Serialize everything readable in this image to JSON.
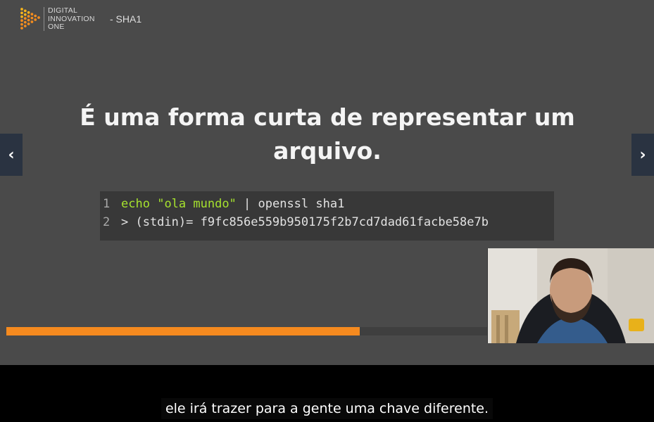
{
  "brand": {
    "name_lines": [
      "DIGITAL",
      "INNOVATION",
      "ONE"
    ],
    "slide_tag": "- SHA1",
    "logo_colors": [
      "#f6b31c",
      "#f28c1f",
      "#e24a2a",
      "#c0143c"
    ]
  },
  "slide": {
    "title": "É uma forma curta de representar um arquivo.",
    "code": {
      "lines": [
        {
          "number": "1",
          "keyword": "echo",
          "string": "\"ola mundo\"",
          "rest": " | openssl sha1"
        },
        {
          "number": "2",
          "text": "> (stdin)= f9fc856e559b950175f2b7cd7dad61facbe58e7b"
        }
      ]
    }
  },
  "progress": {
    "fraction": 0.735,
    "color": "#f58a1f"
  },
  "navigation": {
    "prev_icon": "chevron-left-icon",
    "next_icon": "chevron-right-icon",
    "prev_glyph": "‹",
    "next_glyph": "›"
  },
  "caption": {
    "text": "ele irá trazer para a gente uma chave diferente."
  }
}
